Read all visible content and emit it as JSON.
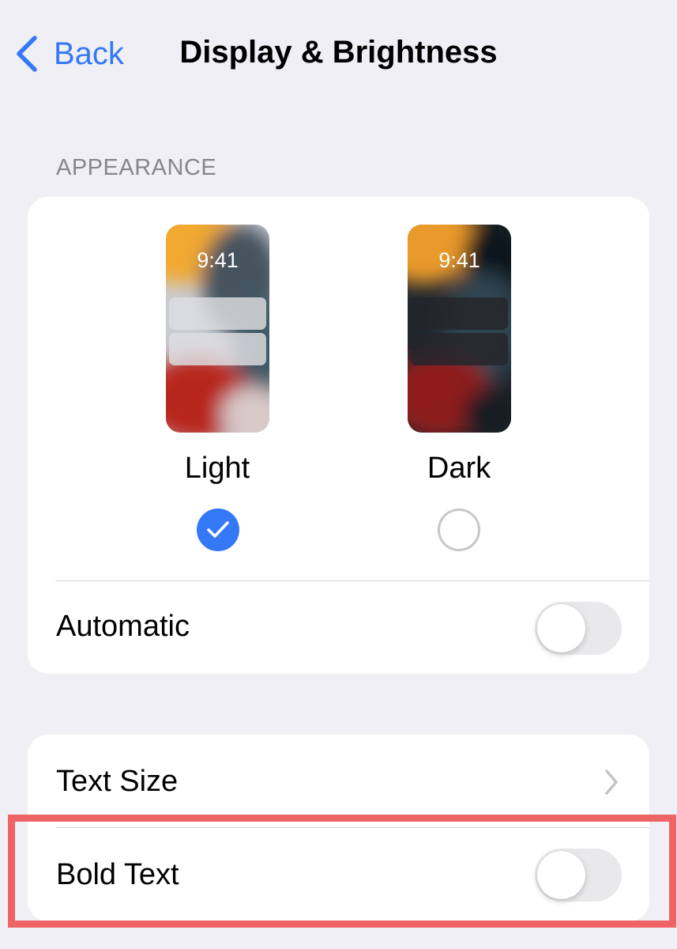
{
  "nav": {
    "back_label": "Back",
    "title": "Display & Brightness"
  },
  "appearance": {
    "section_header": "APPEARANCE",
    "light": {
      "time": "9:41",
      "label": "Light",
      "selected": true
    },
    "dark": {
      "time": "9:41",
      "label": "Dark",
      "selected": false
    },
    "automatic": {
      "label": "Automatic",
      "on": false
    }
  },
  "text_settings": {
    "text_size_label": "Text Size",
    "bold_text": {
      "label": "Bold Text",
      "on": false
    }
  },
  "colors": {
    "accent": "#3478f6",
    "background": "#f0eff5",
    "highlight": "#ee6464"
  },
  "icons": [
    "chevron-left-icon",
    "checkmark-icon",
    "chevron-right-icon"
  ]
}
